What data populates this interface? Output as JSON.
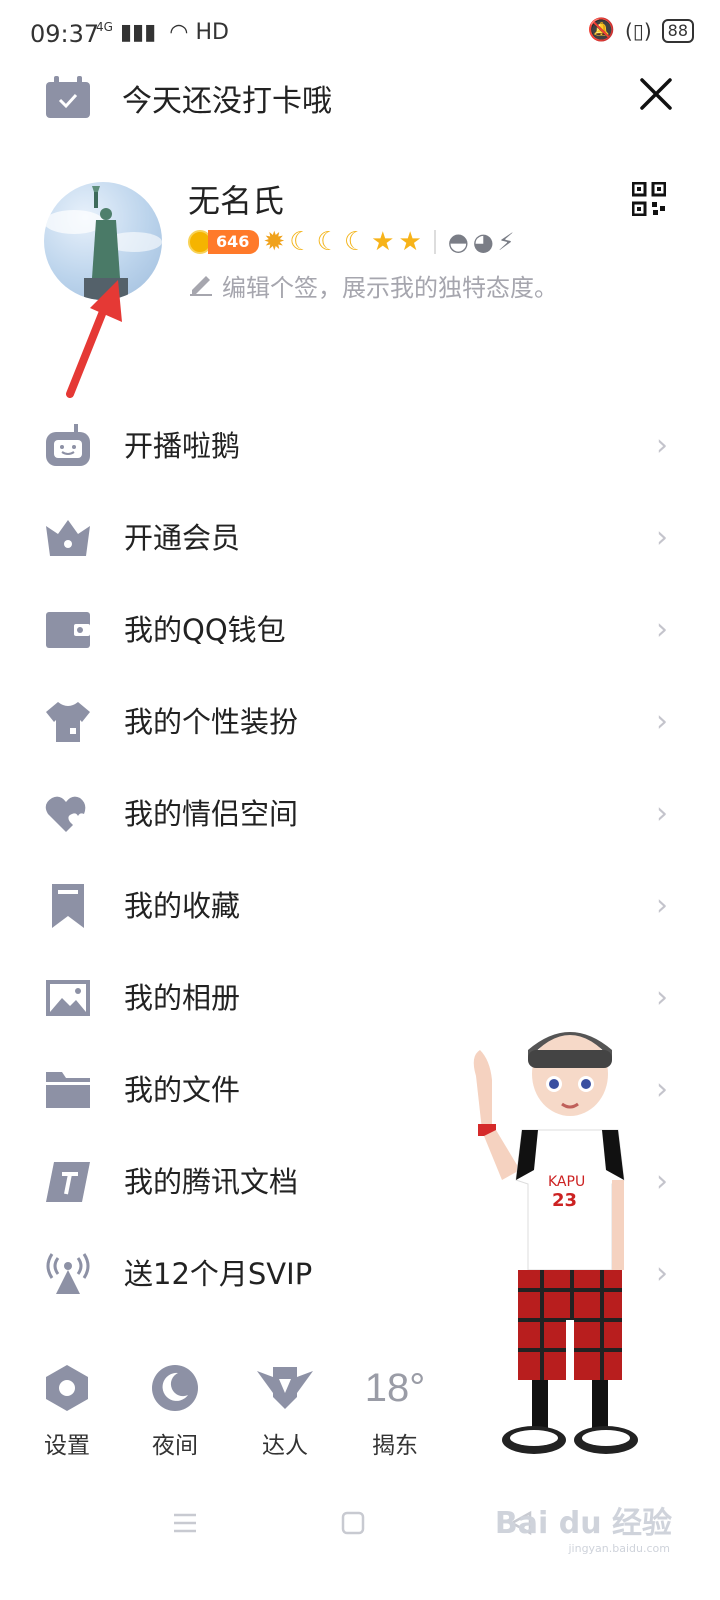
{
  "status": {
    "time": "09:37",
    "network": "4G",
    "hd": "HD",
    "battery": "88"
  },
  "checkin": {
    "text": "今天还没打卡哦"
  },
  "profile": {
    "name": "无名氏",
    "coins": "646",
    "signature": "编辑个签，展示我的独特态度。"
  },
  "menu": [
    {
      "label": "开播啦鹅",
      "icon": "tv-robot-icon"
    },
    {
      "label": "开通会员",
      "icon": "crown-icon"
    },
    {
      "label": "我的QQ钱包",
      "icon": "wallet-icon"
    },
    {
      "label": "我的个性装扮",
      "icon": "tshirt-icon"
    },
    {
      "label": "我的情侣空间",
      "icon": "hearts-icon"
    },
    {
      "label": "我的收藏",
      "icon": "bookmark-icon"
    },
    {
      "label": "我的相册",
      "icon": "photo-icon"
    },
    {
      "label": "我的文件",
      "icon": "folder-icon"
    },
    {
      "label": "我的腾讯文档",
      "icon": "tencent-doc-icon"
    },
    {
      "label": "送12个月SVIP",
      "icon": "broadcast-icon"
    }
  ],
  "bottom": {
    "settings": "设置",
    "night": "夜间",
    "expert": "达人",
    "weather_temp": "18°",
    "weather_city": "揭东"
  },
  "watermark": {
    "brand": "Bai du 经验",
    "url": "jingyan.baidu.com"
  },
  "colors": {
    "icon": "#8d91a5",
    "coin_badge": "#ff7a2a",
    "arrow": "#e53935"
  }
}
